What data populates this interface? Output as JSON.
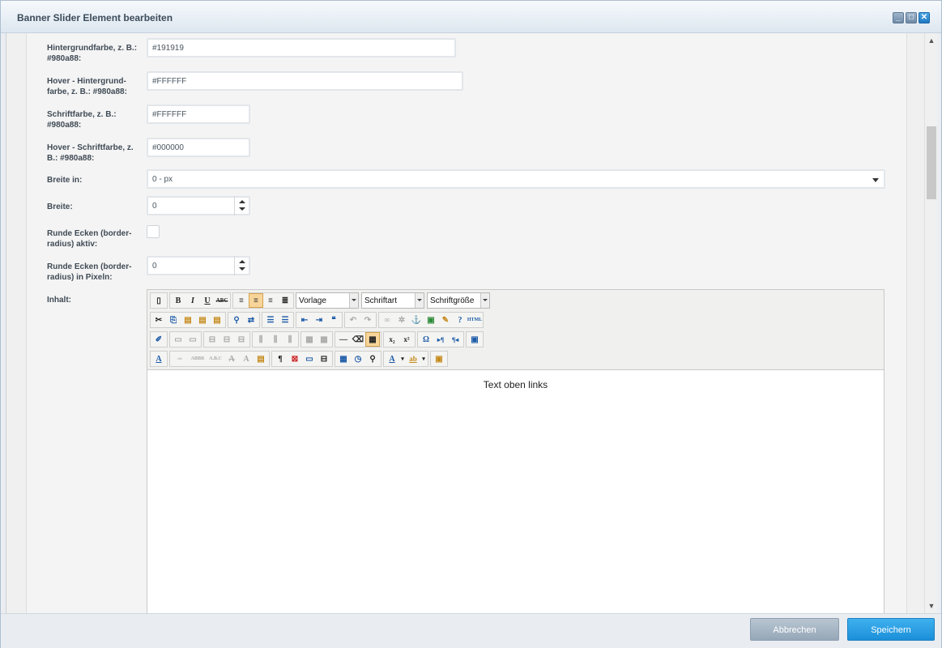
{
  "window": {
    "title": "Banner Slider Element bearbeiten"
  },
  "fields": {
    "bg_color": {
      "label": "Hintergrundfarbe, z. B.: #980a88:",
      "value": "#191919"
    },
    "hover_bg_color": {
      "label": "Hover - Hintergrund-farbe, z. B.: #980a88:",
      "value": "#FFFFFF"
    },
    "font_color": {
      "label": "Schriftfarbe, z. B.: #980a88:",
      "value": "#FFFFFF"
    },
    "hover_font_color": {
      "label": "Hover - Schriftfarbe, z. B.: #980a88:",
      "value": "#000000"
    },
    "width_unit": {
      "label": "Breite in:",
      "value": "0 - px"
    },
    "width": {
      "label": "Breite:",
      "value": "0"
    },
    "rounded_active": {
      "label": "Runde Ecken (border-radius) aktiv:",
      "checked": false
    },
    "rounded_px": {
      "label": "Runde Ecken (border-radius) in Pixeln:",
      "value": "0"
    },
    "content": {
      "label": "Inhalt:"
    }
  },
  "editor": {
    "dropdowns": {
      "format": "Vorlage",
      "font": "Schriftart",
      "size": "Schriftgröße"
    },
    "text": "Text oben links"
  },
  "footer": {
    "cancel_label": "Abbrechen",
    "save_label": "Speichern"
  }
}
